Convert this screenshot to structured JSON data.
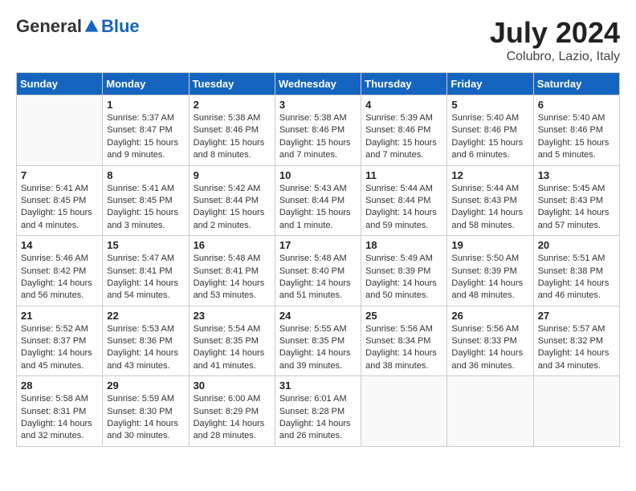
{
  "header": {
    "logo_general": "General",
    "logo_blue": "Blue",
    "month_title": "July 2024",
    "location": "Colubro, Lazio, Italy"
  },
  "days_of_week": [
    "Sunday",
    "Monday",
    "Tuesday",
    "Wednesday",
    "Thursday",
    "Friday",
    "Saturday"
  ],
  "weeks": [
    [
      {
        "day": "",
        "info": ""
      },
      {
        "day": "1",
        "info": "Sunrise: 5:37 AM\nSunset: 8:47 PM\nDaylight: 15 hours\nand 9 minutes."
      },
      {
        "day": "2",
        "info": "Sunrise: 5:38 AM\nSunset: 8:46 PM\nDaylight: 15 hours\nand 8 minutes."
      },
      {
        "day": "3",
        "info": "Sunrise: 5:38 AM\nSunset: 8:46 PM\nDaylight: 15 hours\nand 7 minutes."
      },
      {
        "day": "4",
        "info": "Sunrise: 5:39 AM\nSunset: 8:46 PM\nDaylight: 15 hours\nand 7 minutes."
      },
      {
        "day": "5",
        "info": "Sunrise: 5:40 AM\nSunset: 8:46 PM\nDaylight: 15 hours\nand 6 minutes."
      },
      {
        "day": "6",
        "info": "Sunrise: 5:40 AM\nSunset: 8:46 PM\nDaylight: 15 hours\nand 5 minutes."
      }
    ],
    [
      {
        "day": "7",
        "info": "Sunrise: 5:41 AM\nSunset: 8:45 PM\nDaylight: 15 hours\nand 4 minutes."
      },
      {
        "day": "8",
        "info": "Sunrise: 5:41 AM\nSunset: 8:45 PM\nDaylight: 15 hours\nand 3 minutes."
      },
      {
        "day": "9",
        "info": "Sunrise: 5:42 AM\nSunset: 8:44 PM\nDaylight: 15 hours\nand 2 minutes."
      },
      {
        "day": "10",
        "info": "Sunrise: 5:43 AM\nSunset: 8:44 PM\nDaylight: 15 hours\nand 1 minute."
      },
      {
        "day": "11",
        "info": "Sunrise: 5:44 AM\nSunset: 8:44 PM\nDaylight: 14 hours\nand 59 minutes."
      },
      {
        "day": "12",
        "info": "Sunrise: 5:44 AM\nSunset: 8:43 PM\nDaylight: 14 hours\nand 58 minutes."
      },
      {
        "day": "13",
        "info": "Sunrise: 5:45 AM\nSunset: 8:43 PM\nDaylight: 14 hours\nand 57 minutes."
      }
    ],
    [
      {
        "day": "14",
        "info": "Sunrise: 5:46 AM\nSunset: 8:42 PM\nDaylight: 14 hours\nand 56 minutes."
      },
      {
        "day": "15",
        "info": "Sunrise: 5:47 AM\nSunset: 8:41 PM\nDaylight: 14 hours\nand 54 minutes."
      },
      {
        "day": "16",
        "info": "Sunrise: 5:48 AM\nSunset: 8:41 PM\nDaylight: 14 hours\nand 53 minutes."
      },
      {
        "day": "17",
        "info": "Sunrise: 5:48 AM\nSunset: 8:40 PM\nDaylight: 14 hours\nand 51 minutes."
      },
      {
        "day": "18",
        "info": "Sunrise: 5:49 AM\nSunset: 8:39 PM\nDaylight: 14 hours\nand 50 minutes."
      },
      {
        "day": "19",
        "info": "Sunrise: 5:50 AM\nSunset: 8:39 PM\nDaylight: 14 hours\nand 48 minutes."
      },
      {
        "day": "20",
        "info": "Sunrise: 5:51 AM\nSunset: 8:38 PM\nDaylight: 14 hours\nand 46 minutes."
      }
    ],
    [
      {
        "day": "21",
        "info": "Sunrise: 5:52 AM\nSunset: 8:37 PM\nDaylight: 14 hours\nand 45 minutes."
      },
      {
        "day": "22",
        "info": "Sunrise: 5:53 AM\nSunset: 8:36 PM\nDaylight: 14 hours\nand 43 minutes."
      },
      {
        "day": "23",
        "info": "Sunrise: 5:54 AM\nSunset: 8:35 PM\nDaylight: 14 hours\nand 41 minutes."
      },
      {
        "day": "24",
        "info": "Sunrise: 5:55 AM\nSunset: 8:35 PM\nDaylight: 14 hours\nand 39 minutes."
      },
      {
        "day": "25",
        "info": "Sunrise: 5:56 AM\nSunset: 8:34 PM\nDaylight: 14 hours\nand 38 minutes."
      },
      {
        "day": "26",
        "info": "Sunrise: 5:56 AM\nSunset: 8:33 PM\nDaylight: 14 hours\nand 36 minutes."
      },
      {
        "day": "27",
        "info": "Sunrise: 5:57 AM\nSunset: 8:32 PM\nDaylight: 14 hours\nand 34 minutes."
      }
    ],
    [
      {
        "day": "28",
        "info": "Sunrise: 5:58 AM\nSunset: 8:31 PM\nDaylight: 14 hours\nand 32 minutes."
      },
      {
        "day": "29",
        "info": "Sunrise: 5:59 AM\nSunset: 8:30 PM\nDaylight: 14 hours\nand 30 minutes."
      },
      {
        "day": "30",
        "info": "Sunrise: 6:00 AM\nSunset: 8:29 PM\nDaylight: 14 hours\nand 28 minutes."
      },
      {
        "day": "31",
        "info": "Sunrise: 6:01 AM\nSunset: 8:28 PM\nDaylight: 14 hours\nand 26 minutes."
      },
      {
        "day": "",
        "info": ""
      },
      {
        "day": "",
        "info": ""
      },
      {
        "day": "",
        "info": ""
      }
    ]
  ]
}
